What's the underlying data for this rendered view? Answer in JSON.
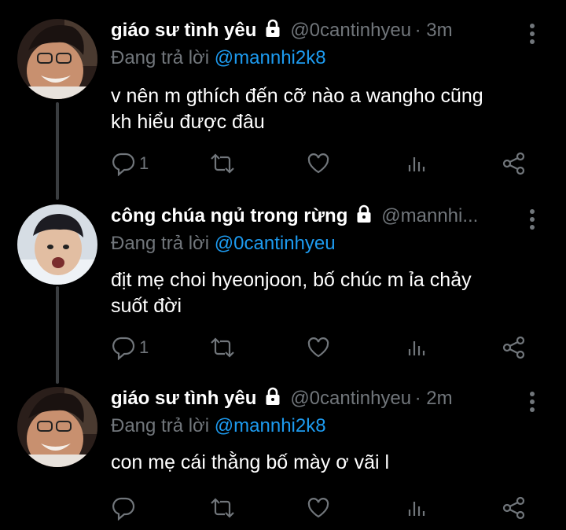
{
  "tweets": [
    {
      "name": "giáo sư tình yêu",
      "handle": "@0cantinhyeu",
      "time": "· 3m",
      "replying_label": "Đang trả lời",
      "replying_to": "@mannhi2k8",
      "text_lines": [
        "v nên m gthích đến cỡ nào a wangho cũng",
        "kh hiểu được đâu"
      ],
      "reply_count": "1"
    },
    {
      "name": "công chúa ngủ trong rừng",
      "handle": "@mannhi...",
      "time": "",
      "replying_label": "Đang trả lời",
      "replying_to": "@0cantinhyeu",
      "text_lines": [
        "địt mẹ choi hyeonjoon, bố chúc m ỉa chảy",
        "suốt đời"
      ],
      "reply_count": "1"
    },
    {
      "name": "giáo sư tình yêu",
      "handle": "@0cantinhyeu",
      "time": "· 2m",
      "replying_label": "Đang trả lời",
      "replying_to": "@mannhi2k8",
      "text_lines": [
        "con mẹ cái thằng bố mày ơ vãi l"
      ],
      "reply_count": ""
    }
  ],
  "icons": {
    "reply": "reply-icon",
    "retweet": "retweet-icon",
    "like": "heart-icon",
    "views": "analytics-icon",
    "share": "share-icon",
    "lock": "lock-icon",
    "more": "more-vertical-icon"
  },
  "colors": {
    "background": "#000000",
    "muted": "#71767b",
    "mention": "#1d9bf0"
  }
}
